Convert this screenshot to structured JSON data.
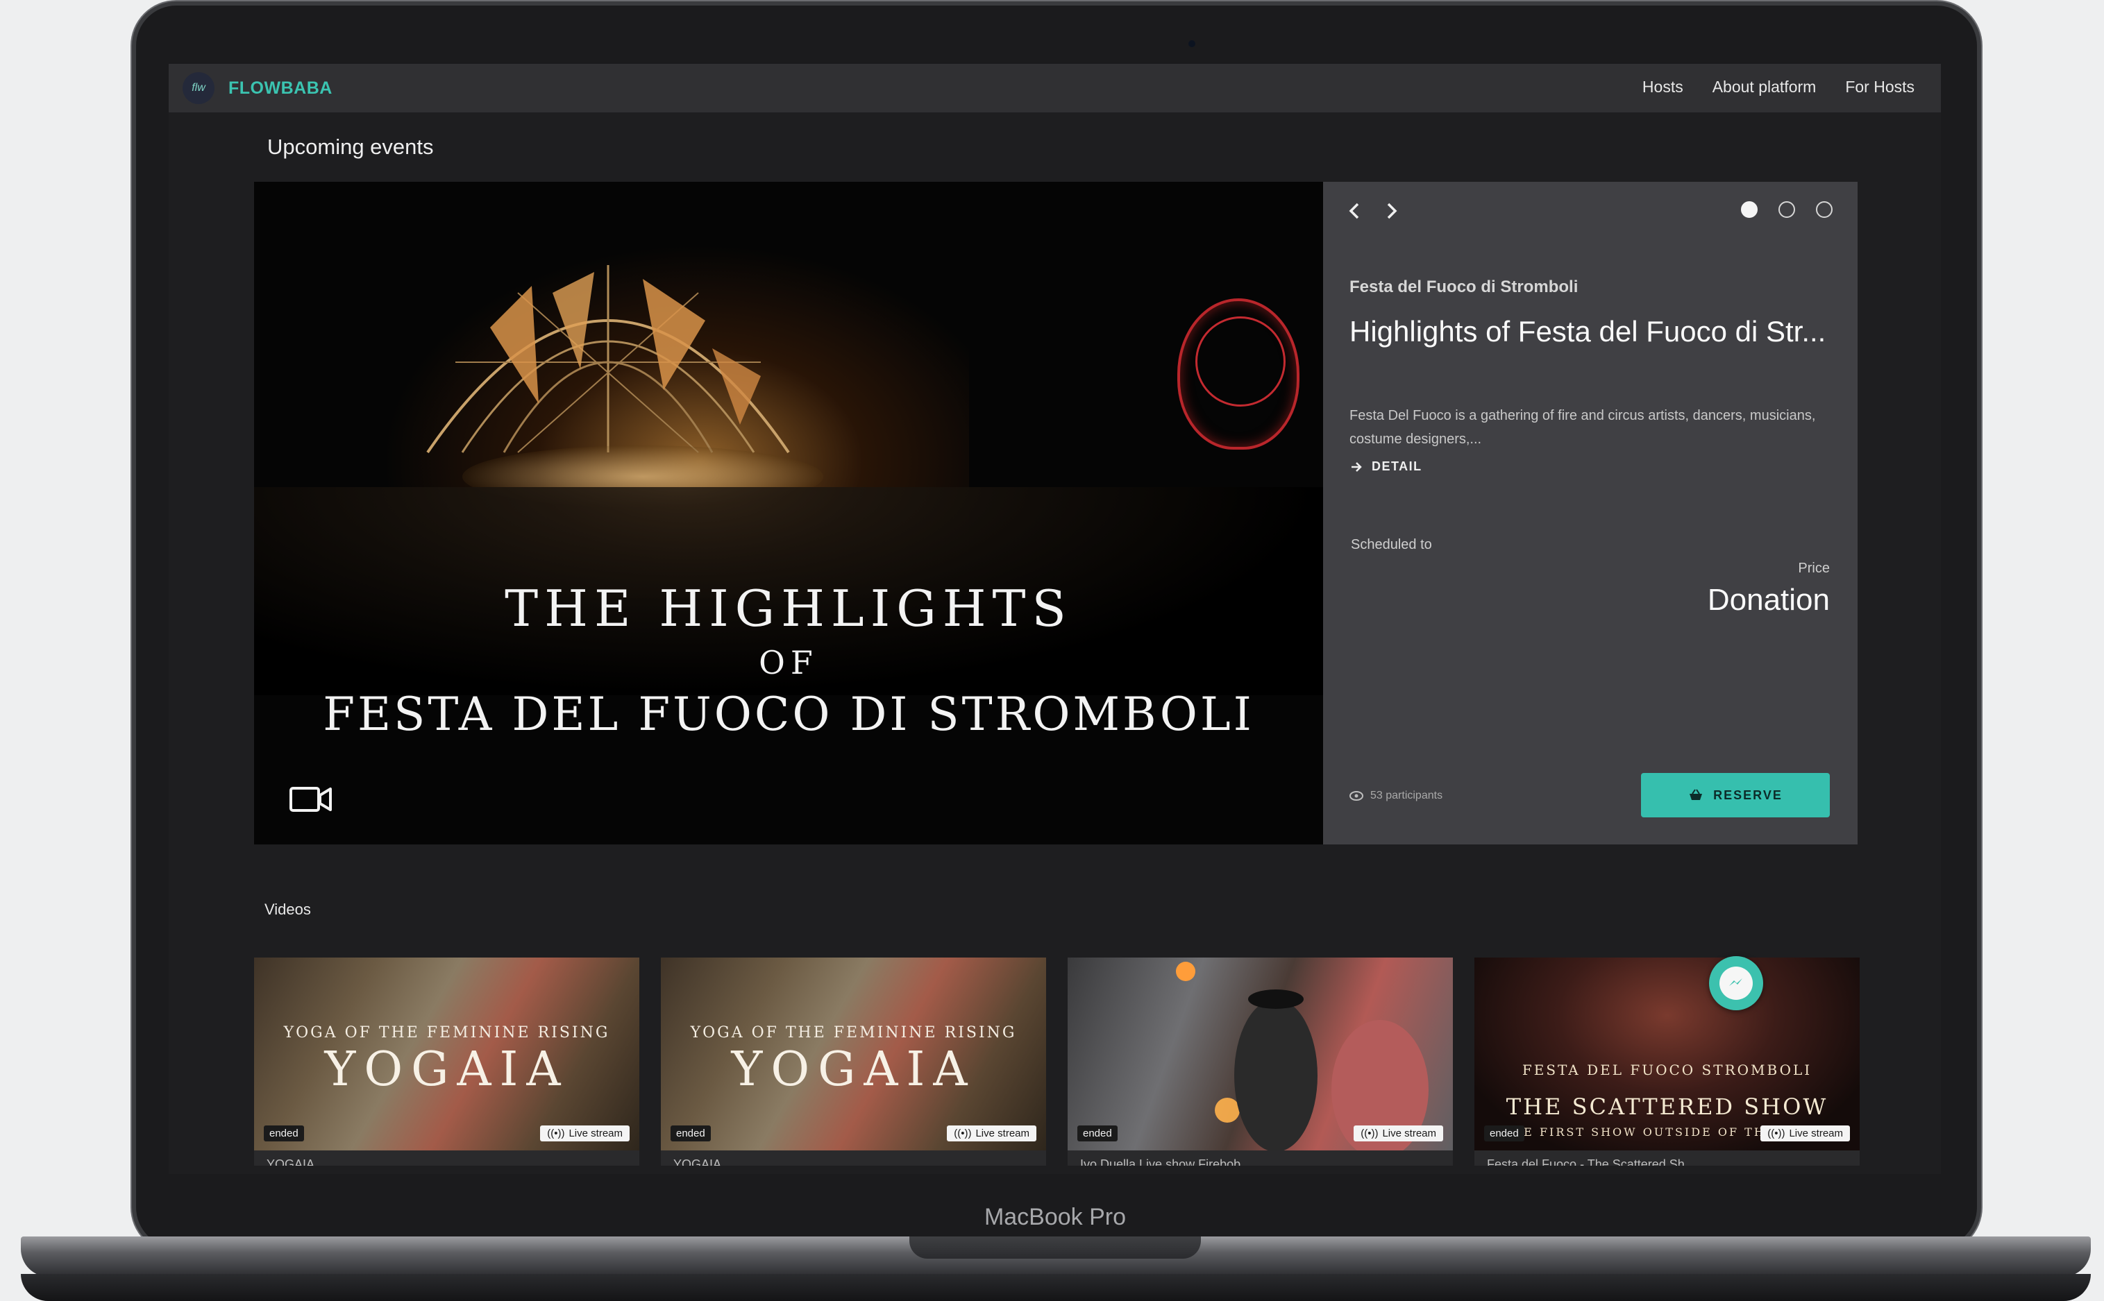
{
  "device": {
    "model_label": "MacBook Pro"
  },
  "nav": {
    "logo_text": "flw",
    "brand": "FLOWBABA",
    "links": [
      "Hosts",
      "About platform",
      "For Hosts"
    ]
  },
  "upcoming": {
    "heading": "Upcoming events",
    "hero": {
      "title_line1": "The Highlights",
      "title_line2": "of",
      "title_line3": "Festa del Fuoco di Stromboli"
    },
    "event": {
      "host": "Festa del Fuoco di Stromboli",
      "title": "Highlights of Festa del Fuoco di Str...",
      "description": "Festa Del Fuoco is a gathering of fire and circus artists, dancers, musicians, costume designers,...",
      "detail_label": "DETAIL",
      "scheduled_label": "Scheduled to",
      "price_label": "Price",
      "price": "Donation",
      "participants": "53 participants",
      "reserve_label": "RESERVE"
    },
    "carousel": {
      "slide_count": 3,
      "active_index": 0
    }
  },
  "videos": {
    "heading": "Videos",
    "items": [
      {
        "sub": "YOGA OF THE FEMININE RISING",
        "main": "YOGAIA",
        "ended": "ended",
        "live": "Live stream",
        "title": "YOGAIA"
      },
      {
        "sub": "YOGA OF THE FEMININE RISING",
        "main": "YOGAIA",
        "ended": "ended",
        "live": "Live stream",
        "title": "YOGAIA"
      },
      {
        "sub": "",
        "main": "",
        "ended": "ended",
        "live": "Live stream",
        "title": "Ivo Duella Live show Firebob..."
      },
      {
        "sub": "FESTA DEL FUOCO STROMBOLI",
        "main": "THE SCATTERED SHOW",
        "sub2": "THE FIRST SHOW OUTSIDE OF THE",
        "ended": "ended",
        "live": "Live stream",
        "title": "Festa del Fuoco - The Scattered Sh..."
      }
    ]
  },
  "colors": {
    "accent": "#36bfae",
    "brand": "#3bc4b1",
    "panel": "#404044"
  }
}
